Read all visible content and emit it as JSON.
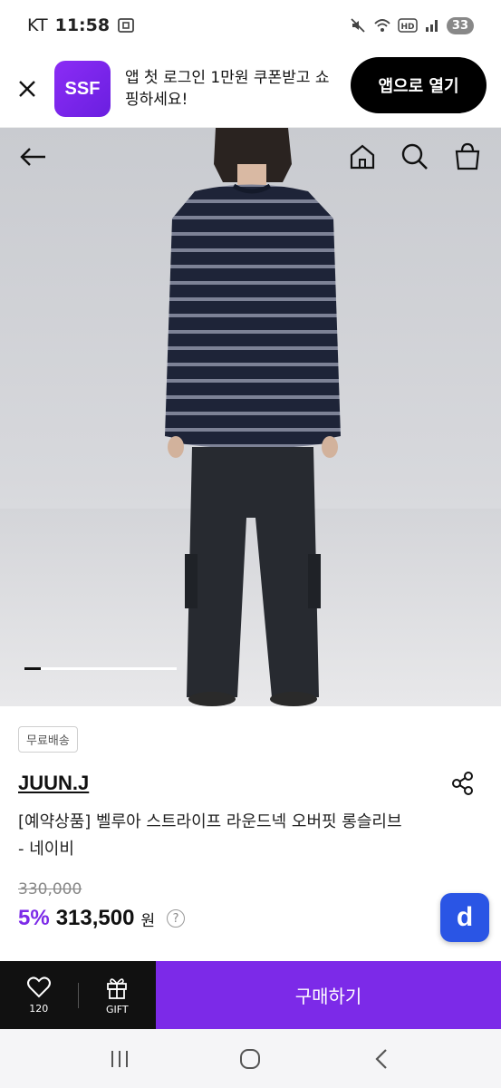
{
  "status_bar": {
    "carrier": "KT",
    "time": "11:58",
    "battery": "33"
  },
  "app_banner": {
    "logo_text": "SSF",
    "message": "앱 첫 로그인 1만원 쿠폰받고 쇼핑하세요!",
    "open_button": "앱으로 열기"
  },
  "header": {
    "icons": [
      "back-arrow-icon",
      "home-icon",
      "search-icon",
      "shopping-bag-icon"
    ]
  },
  "gallery": {
    "progress": 0.11
  },
  "product": {
    "badge": "무료배송",
    "brand": "JUUN.J",
    "name": "[예약상품] 벨루아 스트라이프 라운드넥 오버핏 롱슬리브 - 네이비",
    "original_price": "330,000",
    "discount": "5%",
    "price": "313,500",
    "currency": "원",
    "help": "?",
    "floating_button": "d"
  },
  "bottom_bar": {
    "like_count": "120",
    "gift_label": "GIFT",
    "buy_label": "구매하기"
  },
  "colors": {
    "accent": "#7c2ae8",
    "floating": "#2a55e5"
  }
}
